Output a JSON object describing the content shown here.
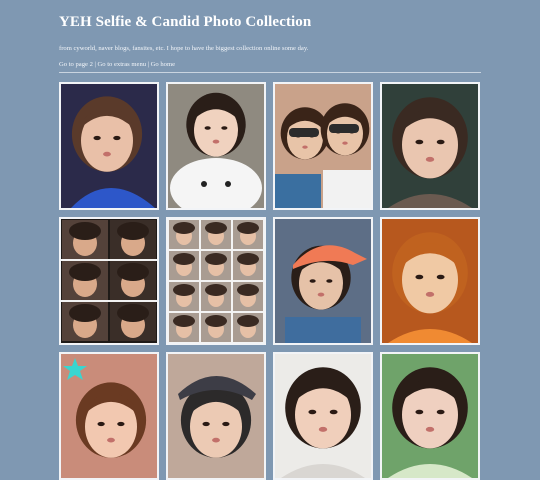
{
  "header": {
    "title": "YEH Selfie & Candid Photo Collection",
    "subtitle": "from cyworld, naver blogs, fansites, etc. I hope to have the biggest collection online some day.",
    "nav": {
      "page2": "Go to page 2",
      "sep1": " | ",
      "extras": "Go to extras menu",
      "sep2": " | ",
      "home": "Go home"
    }
  },
  "photos": [
    {
      "name": "photo-1",
      "kind": "selfie-pout-blue-shirt",
      "colors": {
        "bg": "#2b2a4a",
        "hair": "#5a3a2a",
        "skin": "#e9c0a8",
        "accent": "#2d57c9"
      }
    },
    {
      "name": "photo-2",
      "kind": "selfie-with-plush",
      "colors": {
        "bg": "#8f8a80",
        "hair": "#2a1e18",
        "skin": "#f0d2bf",
        "accent": "#f5f5f5"
      }
    },
    {
      "name": "photo-3",
      "kind": "two-girls-sunglasses",
      "colors": {
        "bg": "#c9a28a",
        "hair": "#3a2418",
        "skin": "#e8c4a8",
        "accent": "#2c2c2c"
      }
    },
    {
      "name": "photo-4",
      "kind": "selfie-pout-close",
      "colors": {
        "bg": "#30403a",
        "hair": "#3a2a22",
        "skin": "#eac6b0",
        "accent": "#6a5a50"
      }
    },
    {
      "name": "photo-5",
      "kind": "collage-six-selfies",
      "colors": {
        "bg": "#1f1a17",
        "hair": "#2a1e18",
        "skin": "#d9a98a",
        "accent": "#f2f2f2"
      }
    },
    {
      "name": "photo-6",
      "kind": "collage-nine-selfies",
      "colors": {
        "bg": "#f4f4f4",
        "hair": "#3a2a22",
        "skin": "#e6c0a6",
        "accent": "#9a8f86"
      }
    },
    {
      "name": "photo-7",
      "kind": "selfie-orange-cap",
      "colors": {
        "bg": "#5d6e86",
        "hair": "#2a1e18",
        "skin": "#e6c2a8",
        "accent": "#f07a55"
      }
    },
    {
      "name": "photo-8",
      "kind": "selfie-orange-hair",
      "colors": {
        "bg": "#b7581e",
        "hair": "#c0621f",
        "skin": "#f0c9a4",
        "accent": "#f08a32"
      }
    },
    {
      "name": "photo-9",
      "kind": "selfie-star-sticker",
      "colors": {
        "bg": "#c98c7a",
        "hair": "#6a3a22",
        "skin": "#f2c8b0",
        "accent": "#39d6d0"
      }
    },
    {
      "name": "photo-10",
      "kind": "selfie-hat",
      "colors": {
        "bg": "#bfa89a",
        "hair": "#2c2a2a",
        "skin": "#eccab4",
        "accent": "#3d3d46"
      }
    },
    {
      "name": "photo-11",
      "kind": "selfie-white-bg",
      "colors": {
        "bg": "#ecebe8",
        "hair": "#2a1e18",
        "skin": "#f0cfbb",
        "accent": "#d9d6d2"
      }
    },
    {
      "name": "photo-12",
      "kind": "selfie-green-bg",
      "colors": {
        "bg": "#6fa36a",
        "hair": "#2a1e18",
        "skin": "#efd0c0",
        "accent": "#d6e8c8"
      }
    }
  ]
}
